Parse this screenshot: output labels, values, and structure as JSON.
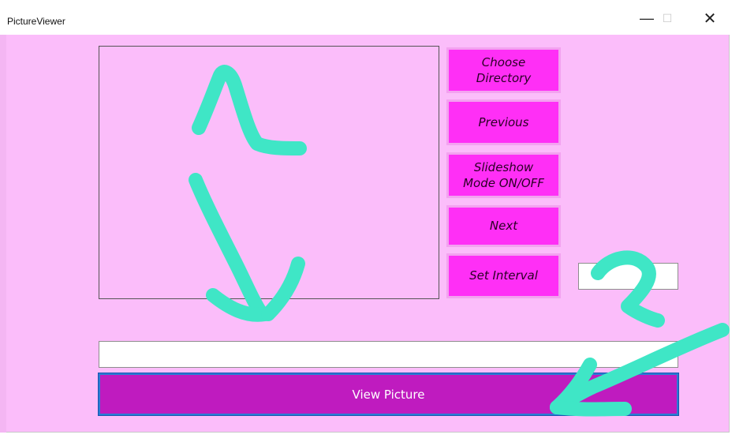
{
  "window": {
    "title": "PictureViewer",
    "controls": {
      "minimize": "—",
      "maximize": "☐",
      "close": "✕"
    }
  },
  "buttons": {
    "choose_directory": "Choose\nDirectory",
    "previous": "Previous",
    "slideshow": "Slideshow\nMode ON/OFF",
    "next": "Next",
    "set_interval": "Set Interval",
    "view_picture": "View Picture"
  },
  "inputs": {
    "interval_value": "",
    "path_value": ""
  },
  "colors": {
    "background": "#fbbdfa",
    "button": "#ff2ff6",
    "view_button": "#bf1bbf",
    "annotation": "#3fe6c6"
  },
  "annotations": {
    "label_1": "1",
    "label_2": "2"
  }
}
